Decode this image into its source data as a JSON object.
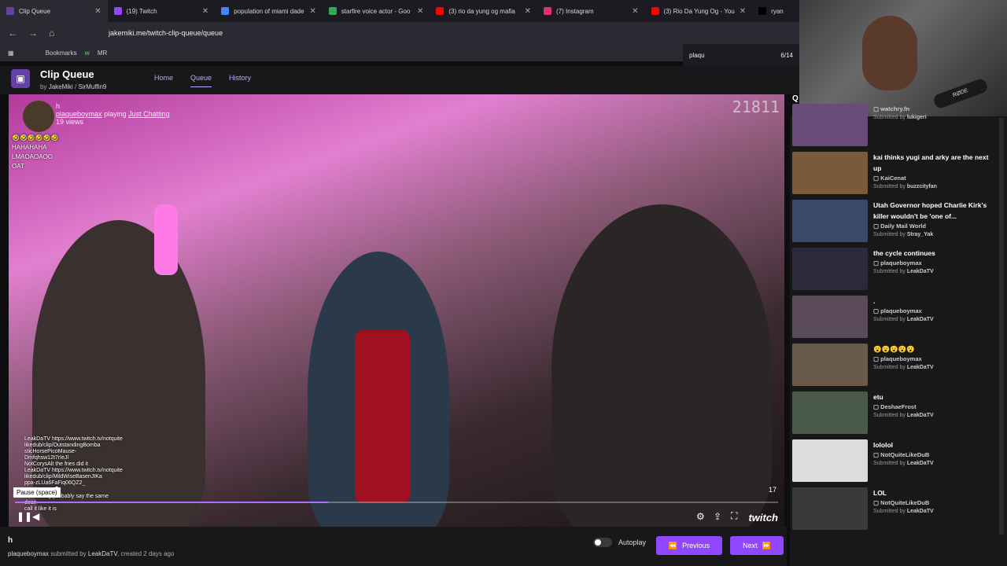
{
  "browser": {
    "tabs": [
      {
        "title": "Clip Queue",
        "color": "#6441a5",
        "active": true
      },
      {
        "title": "(19) Twitch",
        "color": "#9147ff"
      },
      {
        "title": "population of miami dade",
        "color": "#4285f4"
      },
      {
        "title": "starfire voice actor - Goo",
        "color": "#34a853"
      },
      {
        "title": "(3) rio da yung og mafia",
        "color": "#ff0000"
      },
      {
        "title": "(7) Instagram",
        "color": "#e1306c"
      },
      {
        "title": "(3) Rio Da Yung Og - You",
        "color": "#ff0000"
      }
    ],
    "partial_tab": "ryan",
    "url": "jakemiki.me/twitch-clip-queue/queue",
    "bookmarks": [
      "Bookmarks",
      "w",
      "MR"
    ],
    "find": {
      "query": "plaqu",
      "count": "6/14"
    }
  },
  "app": {
    "title": "Clip Queue",
    "by": "by",
    "author1": "JakeMiki",
    "author2": "SirMuffin9",
    "nav": [
      "Home",
      "Queue",
      "History"
    ]
  },
  "player": {
    "counter": "21811",
    "channel": "plaqueboymax",
    "playing_label": "playing",
    "category": "Just Chatting",
    "views": "19 views",
    "overlay_h": "h",
    "chat_top": [
      "🤣🤣🤣🤣🤣🤣",
      "HAHAHAHA",
      "LMAOAOAOO",
      "",
      "OAT"
    ],
    "chat_bottom": [
      "LeakDaTV https://www.twitch.tv/notquite",
      "likedub/clip/OutstandingBomba",
      "sticHorsePicoMause-",
      "Dmfqhsw12t7rIeJl",
      "NotCorysAlt the fries did it",
      "LeakDaTV https://www.twitch.tv/notquite",
      "likedub/clip/MildWiseBasenJIKa",
      "ppa-zLUa6FaFiq06QZ2_",
      "mrminttea3 🍺",
      "embrs they probably say the same",
      "dean",
      "call it like it is"
    ],
    "tooltip": "Pause (space)",
    "duration": "17",
    "progress": 0.41,
    "watermark": "twitch"
  },
  "bottom": {
    "h": "h",
    "channel": "plaqueboymax",
    "submitted_by": "submitted by",
    "submitter": "LeakDaTV",
    "created": ", created 2 days ago",
    "autoplay": "Autoplay",
    "previous": "Previous",
    "next": "Next"
  },
  "queue": {
    "header": "Q",
    "items": [
      {
        "title": "",
        "channel": "watchry.fn",
        "submitter": "lukigeri",
        "thumb": "#6a4c7a"
      },
      {
        "title": "kai thinks yugi and arky are the next up",
        "channel": "KaiCenat",
        "submitter": "buzzcityfan",
        "thumb": "#7a5a3a"
      },
      {
        "title": "Utah Governor hoped Charlie Kirk's killer wouldn't be 'one of...",
        "channel": "Daily Mail World",
        "submitter": "Stray_Yak",
        "thumb": "#3a4a6a"
      },
      {
        "title": "the cycle continues",
        "channel": "plaqueboymax",
        "submitter": "LeakDaTV",
        "thumb": "#2a2a3a"
      },
      {
        "title": ".",
        "channel": "plaqueboymax",
        "submitter": "LeakDaTV",
        "thumb": "#5a4a5a"
      },
      {
        "title": "😮😮😮😮😮",
        "channel": "plaqueboymax",
        "submitter": "LeakDaTV",
        "thumb": "#6a5a4a"
      },
      {
        "title": "etu",
        "channel": "DeshaeFrost",
        "submitter": "LeakDaTV",
        "thumb": "#4a5a4a"
      },
      {
        "title": "lololol",
        "channel": "NotQuiteLikeDuB",
        "submitter": "LeakDaTV",
        "thumb": "#dcdcdc"
      },
      {
        "title": "LOL",
        "channel": "NotQuiteLikeDuB",
        "submitter": "LeakDaTV",
        "thumb": "#3a3a3a"
      }
    ],
    "submitted_label": "Submitted by"
  },
  "webcam": {
    "mic_label": "RØDE"
  }
}
